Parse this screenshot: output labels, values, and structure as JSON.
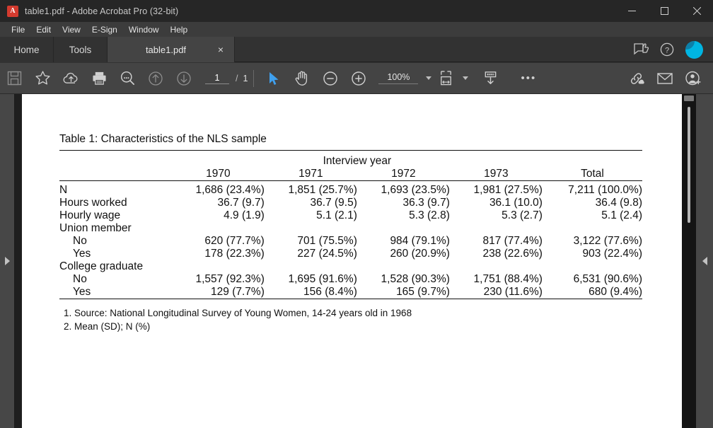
{
  "window": {
    "title": "table1.pdf - Adobe Acrobat Pro (32-bit)",
    "app_icon_glyph": "A",
    "minimize_label": "Minimize",
    "maximize_label": "Maximize",
    "close_label": "Close"
  },
  "menubar": {
    "items": [
      "File",
      "Edit",
      "View",
      "E-Sign",
      "Window",
      "Help"
    ]
  },
  "tabstrip": {
    "home_label": "Home",
    "tools_label": "Tools",
    "document_tab_label": "table1.pdf",
    "close_tab_label": "×",
    "feedback_icon": "feedback-icon",
    "help_icon": "help-icon",
    "account_icon": "account-avatar"
  },
  "toolbar": {
    "save_icon": "save-icon",
    "star_icon": "add-to-favorites-icon",
    "upload_cloud_icon": "upload-to-cloud-icon",
    "print_icon": "print-icon",
    "find_icon": "find-text-icon",
    "prev_page_icon": "previous-page-icon",
    "next_page_icon": "next-page-icon",
    "page_number": "1",
    "page_separator": "/",
    "page_total": "1",
    "select_tool_icon": "select-cursor-icon",
    "hand_tool_icon": "hand-tool-icon",
    "zoom_out_icon": "zoom-out-icon",
    "zoom_in_icon": "zoom-in-icon",
    "zoom_value": "100%",
    "fit_page_icon": "fit-page-icon",
    "scroll_mode_icon": "scroll-mode-icon",
    "more_tools_label": "•••",
    "share_link_icon": "share-link-icon",
    "email_icon": "email-icon",
    "add_user_icon": "add-user-icon"
  },
  "viewer": {
    "left_panel_toggle": "expand-left-panel-arrow",
    "right_panel_toggle": "expand-right-panel-arrow",
    "scrollbar": "vertical-scrollbar"
  },
  "document": {
    "table_title": "Table 1: Characteristics of the NLS sample",
    "span_header": "Interview year",
    "column_headers": [
      "",
      "1970",
      "1971",
      "1972",
      "1973",
      "Total"
    ],
    "rows": [
      {
        "label": "N",
        "indent": false,
        "values": [
          "1,686 (23.4%)",
          "1,851 (25.7%)",
          "1,693 (23.5%)",
          "1,981 (27.5%)",
          "7,211 (100.0%)"
        ]
      },
      {
        "label": "Hours worked",
        "indent": false,
        "values": [
          "36.7 (9.7)",
          "36.7 (9.5)",
          "36.3 (9.7)",
          "36.1 (10.0)",
          "36.4 (9.8)"
        ]
      },
      {
        "label": "Hourly wage",
        "indent": false,
        "values": [
          "4.9 (1.9)",
          "5.1 (2.1)",
          "5.3 (2.8)",
          "5.3 (2.7)",
          "5.1 (2.4)"
        ]
      },
      {
        "label": "Union member",
        "indent": false,
        "values": [
          "",
          "",
          "",
          "",
          ""
        ]
      },
      {
        "label": "No",
        "indent": true,
        "values": [
          "620 (77.7%)",
          "701 (75.5%)",
          "984 (79.1%)",
          "817 (77.4%)",
          "3,122 (77.6%)"
        ]
      },
      {
        "label": "Yes",
        "indent": true,
        "values": [
          "178 (22.3%)",
          "227 (24.5%)",
          "260 (20.9%)",
          "238 (22.6%)",
          "903 (22.4%)"
        ]
      },
      {
        "label": "College graduate",
        "indent": false,
        "values": [
          "",
          "",
          "",
          "",
          ""
        ]
      },
      {
        "label": "No",
        "indent": true,
        "values": [
          "1,557 (92.3%)",
          "1,695 (91.6%)",
          "1,528 (90.3%)",
          "1,751 (88.4%)",
          "6,531 (90.6%)"
        ]
      },
      {
        "label": "Yes",
        "indent": true,
        "values": [
          "129 (7.7%)",
          "156 (8.4%)",
          "165 (9.7%)",
          "230 (11.6%)",
          "680 (9.4%)"
        ]
      }
    ],
    "footnotes": [
      "1. Source: National Longitudinal Survey of Young Women, 14-24 years old in 1968",
      "2. Mean (SD); N (%)"
    ]
  },
  "colors": {
    "titlebar": "#262626",
    "menubar": "#3c3c3c",
    "tabstrip": "#323232",
    "active_tab": "#444444",
    "toolbar": "#444444",
    "viewer_background": "#3f3f3f",
    "page": "#ffffff",
    "accent": "#00b5e2",
    "select_tool_blue": "#3fa0ee",
    "app_icon_red": "#d43b2f"
  }
}
